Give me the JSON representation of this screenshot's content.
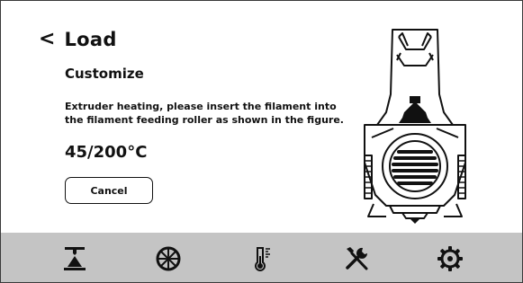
{
  "screen": {
    "title": "Load",
    "back_glyph": "<",
    "subtitle": "Customize",
    "instructions": "Extruder heating, please insert the filament into the filament feeding roller as shown in the figure.",
    "temperature": "45/200°C",
    "cancel_label": "Cancel"
  },
  "nav": {
    "items": [
      {
        "icon": "print-icon"
      },
      {
        "icon": "filament-spool-icon"
      },
      {
        "icon": "thermometer-icon"
      },
      {
        "icon": "tools-icon"
      },
      {
        "icon": "settings-gear-icon"
      }
    ]
  },
  "colors": {
    "text": "#111111",
    "nav_background": "#c4c4c4",
    "background": "#ffffff"
  }
}
